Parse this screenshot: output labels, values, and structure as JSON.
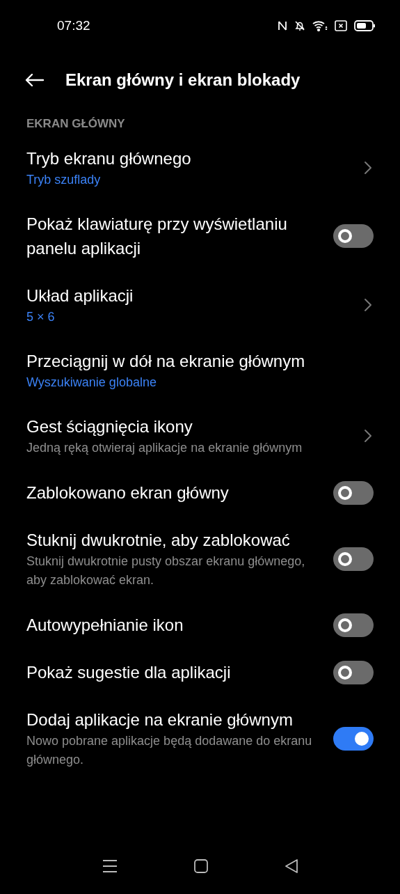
{
  "status_bar": {
    "time": "07:32"
  },
  "header": {
    "title": "Ekran główny i ekran blokady"
  },
  "section": {
    "title": "EKRAN GŁÓWNY"
  },
  "items": [
    {
      "kind": "chevron",
      "title": "Tryb ekranu głównego",
      "value": "Tryb szuflady"
    },
    {
      "kind": "toggle",
      "title": "Pokaż klawiaturę przy wyświetlaniu panelu aplikacji",
      "on": false
    },
    {
      "kind": "chevron",
      "title": "Układ aplikacji",
      "value": "5 × 6"
    },
    {
      "kind": "plain",
      "title": "Przeciągnij w dół na ekranie głównym",
      "value": "Wyszukiwanie globalne"
    },
    {
      "kind": "chevron",
      "title": "Gest ściągnięcia ikony",
      "description": "Jedną ręką otwieraj aplikacje na ekranie głównym"
    },
    {
      "kind": "toggle",
      "title": "Zablokowano ekran główny",
      "on": false
    },
    {
      "kind": "toggle",
      "title": "Stuknij dwukrotnie, aby zablokować",
      "description": "Stuknij dwukrotnie pusty obszar ekranu głównego, aby zablokować ekran.",
      "on": false
    },
    {
      "kind": "toggle",
      "title": "Autowypełnianie ikon",
      "on": false
    },
    {
      "kind": "toggle",
      "title": "Pokaż sugestie dla aplikacji",
      "on": false
    },
    {
      "kind": "toggle",
      "title": "Dodaj aplikacje na ekranie głównym",
      "description": "Nowo pobrane aplikacje będą dodawane do ekranu głównego.",
      "on": true
    }
  ]
}
